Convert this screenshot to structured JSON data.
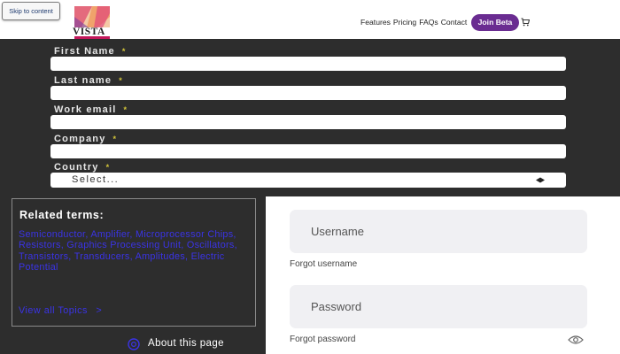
{
  "header": {
    "skip_link": "Skip to content",
    "logo_text": "VISTA",
    "nav": [
      "Features",
      "Pricing",
      "FAQs",
      "Contact"
    ],
    "beta_button": "Join Beta",
    "cart_icon": "cart-icon"
  },
  "form": {
    "fields": [
      {
        "label": "First Name",
        "required": "*"
      },
      {
        "label": "Last name",
        "required": "*"
      },
      {
        "label": "Work email",
        "required": "*"
      },
      {
        "label": "Company",
        "required": "*"
      },
      {
        "label": "Country",
        "required": "*"
      }
    ],
    "country_select": "Select..."
  },
  "related": {
    "title": "Related terms:",
    "terms": "Semiconductor, Amplifier, Microprocessor Chips, Resistors, Graphics Processing Unit, Oscillators, Transistors, Transducers, Amplitudes, Electric Potential",
    "view_all": "View all Topics",
    "view_all_arrow": ">",
    "about": "About this page"
  },
  "login": {
    "username_placeholder": "Username",
    "forgot_username": "Forgot username",
    "password_placeholder": "Password",
    "forgot_password": "Forgot password"
  },
  "colors": {
    "dark_bg": "#2d2d2d",
    "accent": "#6a2c91",
    "link": "#3a33e6",
    "input_bg": "#f0f0f3"
  }
}
